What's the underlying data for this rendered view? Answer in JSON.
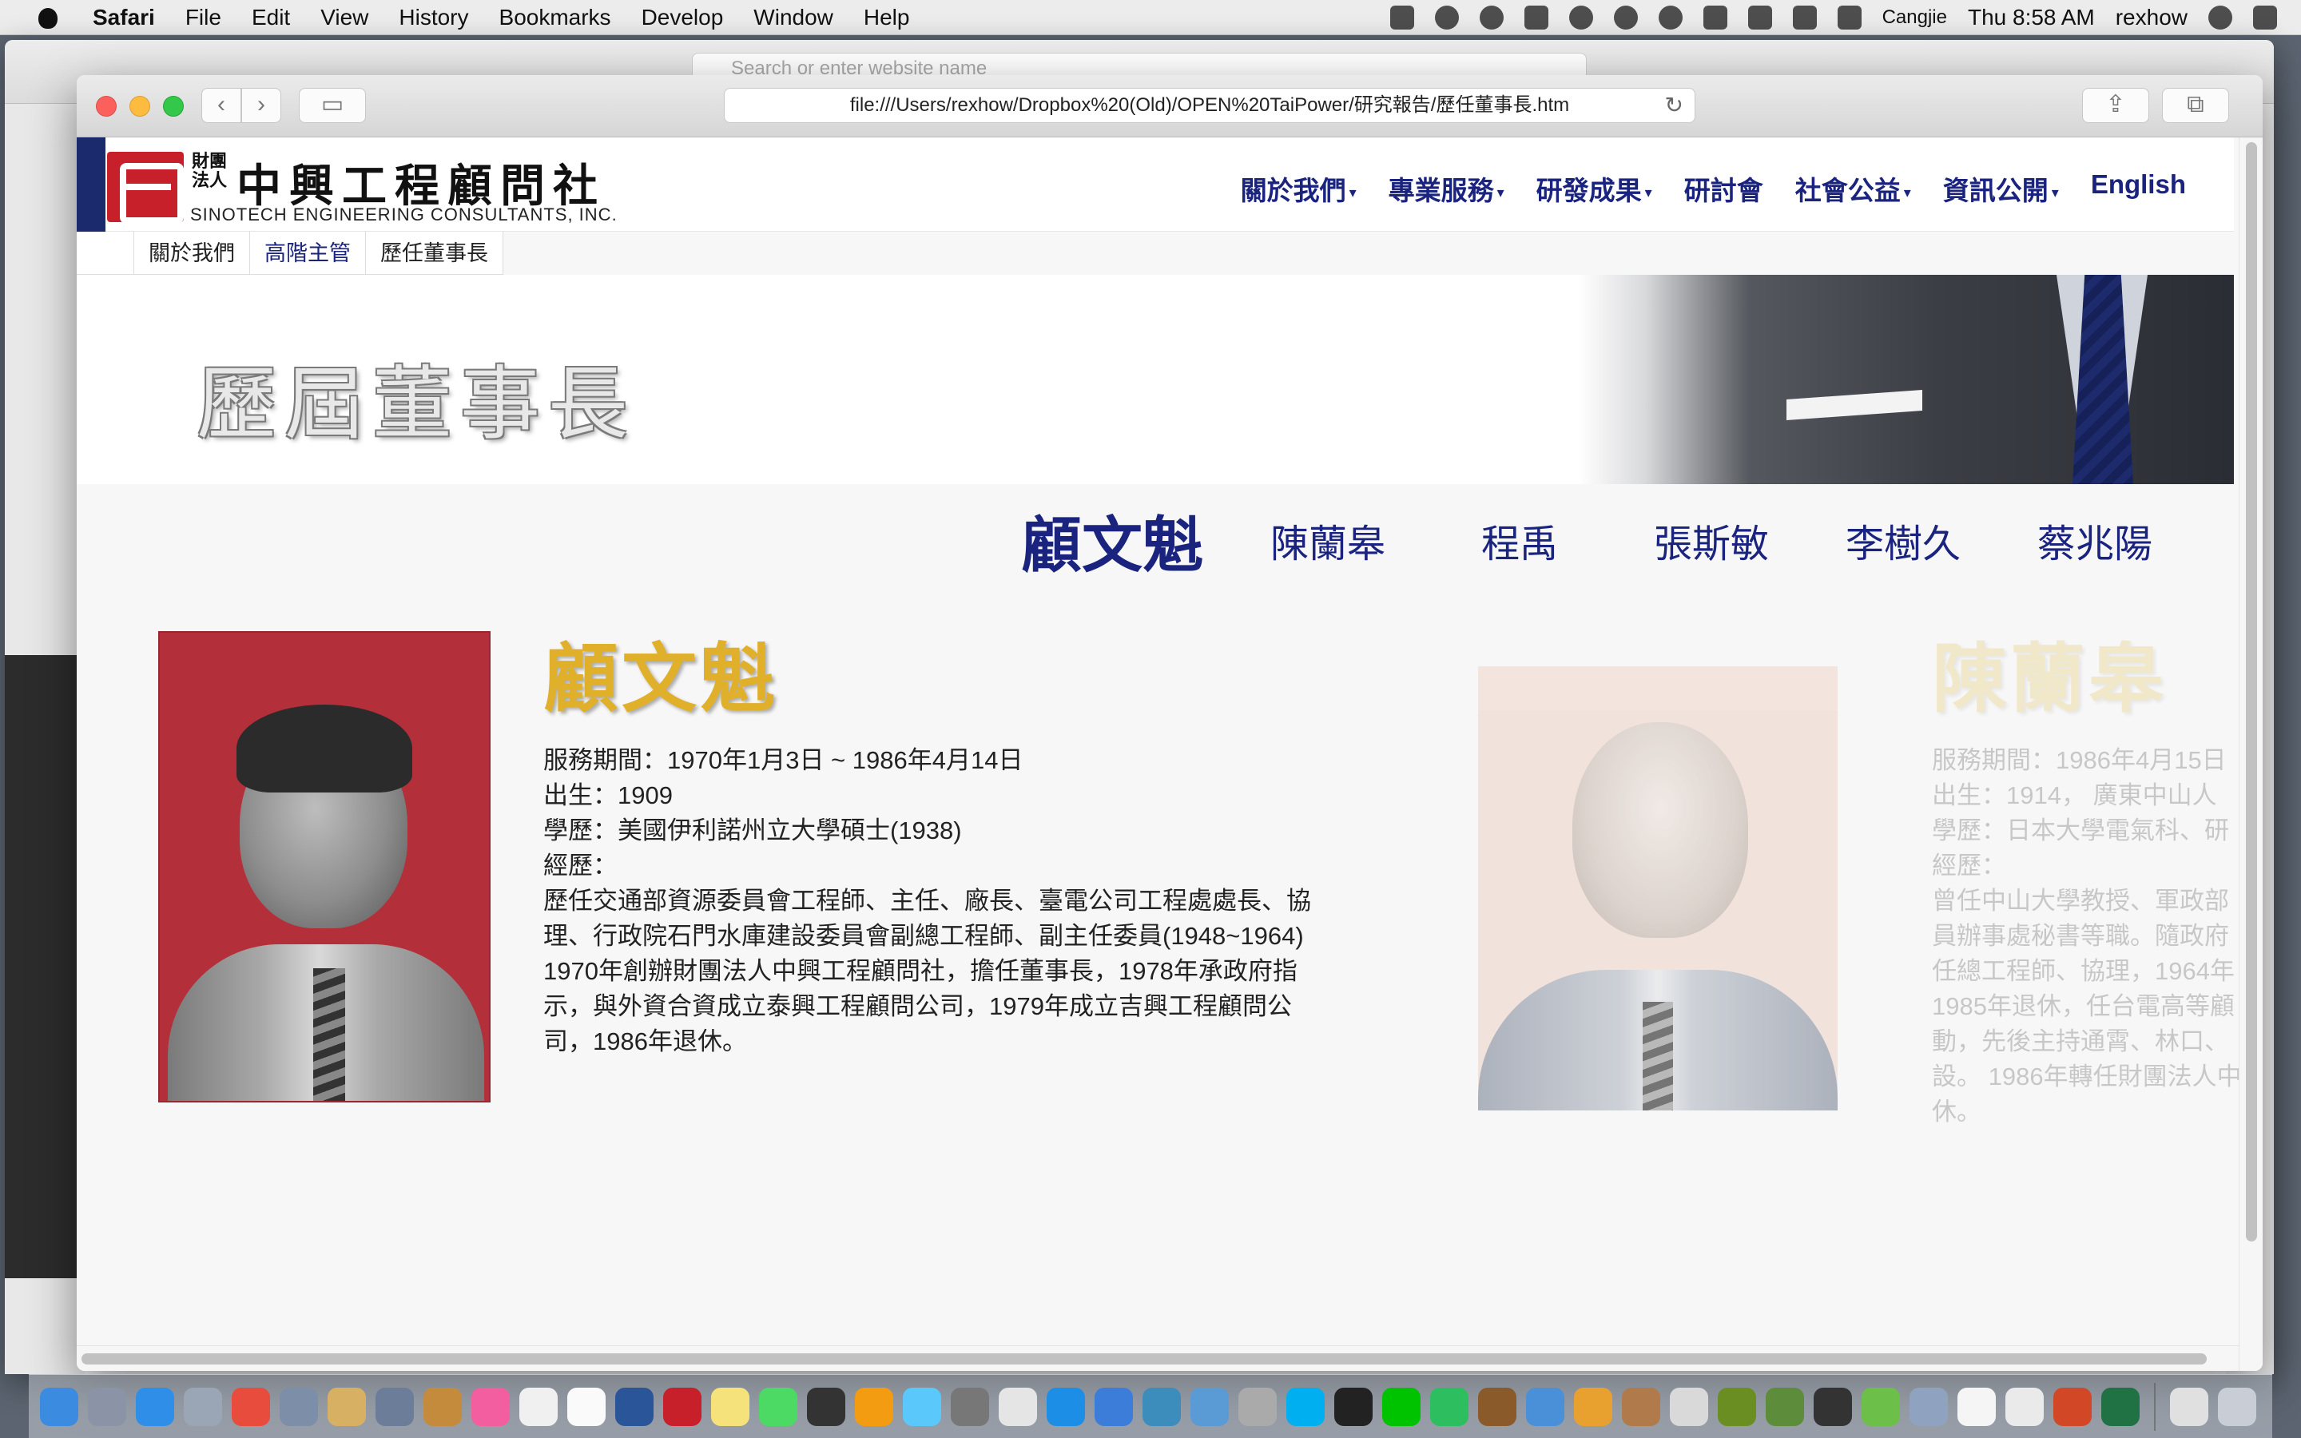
{
  "menubar": {
    "items": [
      "Safari",
      "File",
      "Edit",
      "View",
      "History",
      "Bookmarks",
      "Develop",
      "Window",
      "Help"
    ],
    "input_method": "Cangjie",
    "clock": "Thu 8:58 AM",
    "user": "rexhow"
  },
  "background_window": {
    "search_placeholder": "Search or enter website name"
  },
  "browser": {
    "url": "file:///Users/rexhow/Dropbox%20(Old)/OPEN%20TaiPower/研究報告/歷任董事長.htm"
  },
  "site": {
    "logo_sub": "財團法人",
    "logo_cn": "中興工程顧問社",
    "logo_en": "SINOTECH ENGINEERING CONSULTANTS, INC.",
    "nav": [
      {
        "label": "關於我們",
        "dropdown": true
      },
      {
        "label": "專業服務",
        "dropdown": true
      },
      {
        "label": "研發成果",
        "dropdown": true
      },
      {
        "label": "研討會",
        "dropdown": false
      },
      {
        "label": "社會公益",
        "dropdown": true
      },
      {
        "label": "資訊公開",
        "dropdown": true
      },
      {
        "label": "English",
        "dropdown": false
      }
    ],
    "breadcrumb": [
      "關於我們",
      "高階主管",
      "歷任董事長"
    ],
    "banner_title": "歷屆董事長",
    "chair_tabs": [
      "顧文魁",
      "陳蘭皋",
      "程禹",
      "張斯敏",
      "李樹久",
      "蔡兆陽"
    ],
    "active_tab": 0
  },
  "profiles": [
    {
      "name": "顧文魁",
      "term": "服務期間：1970年1月3日 ~ 1986年4月14日",
      "born": "出生：1909",
      "education": "學歷：美國伊利諾州立大學碩士(1938)",
      "experience_label": "經歷：",
      "experience": [
        "歷任交通部資源委員會工程師、主任、廠長、臺電公司工程處處長、協",
        "理、行政院石門水庫建設委員會副總工程師、副主任委員(1948~1964)",
        "1970年創辦財團法人中興工程顧問社，擔任董事長，1978年承政府指",
        "示，與外資合資成立泰興工程顧問公司，1979年成立吉興工程顧問公",
        "司，1986年退休。"
      ]
    },
    {
      "name": "陳蘭皋",
      "term": "服務期間：1986年4月15日",
      "born": "出生：1914， 廣東中山人",
      "education": "學歷：日本大學電氣科、研",
      "experience_label": "經歷：",
      "experience": [
        "曾任中山大學教授、軍政部",
        "員辦事處秘書等職。隨政府",
        "任總工程師、協理，1964年",
        "1985年退休，任台電高等顧",
        "動，先後主持通霄、林口、",
        "設。 1986年轉任財團法人中",
        "休。"
      ]
    }
  ],
  "colors": {
    "nav_blue": "#1a237e",
    "name_gold": "#e0b02a",
    "logo_red": "#c8202a"
  }
}
